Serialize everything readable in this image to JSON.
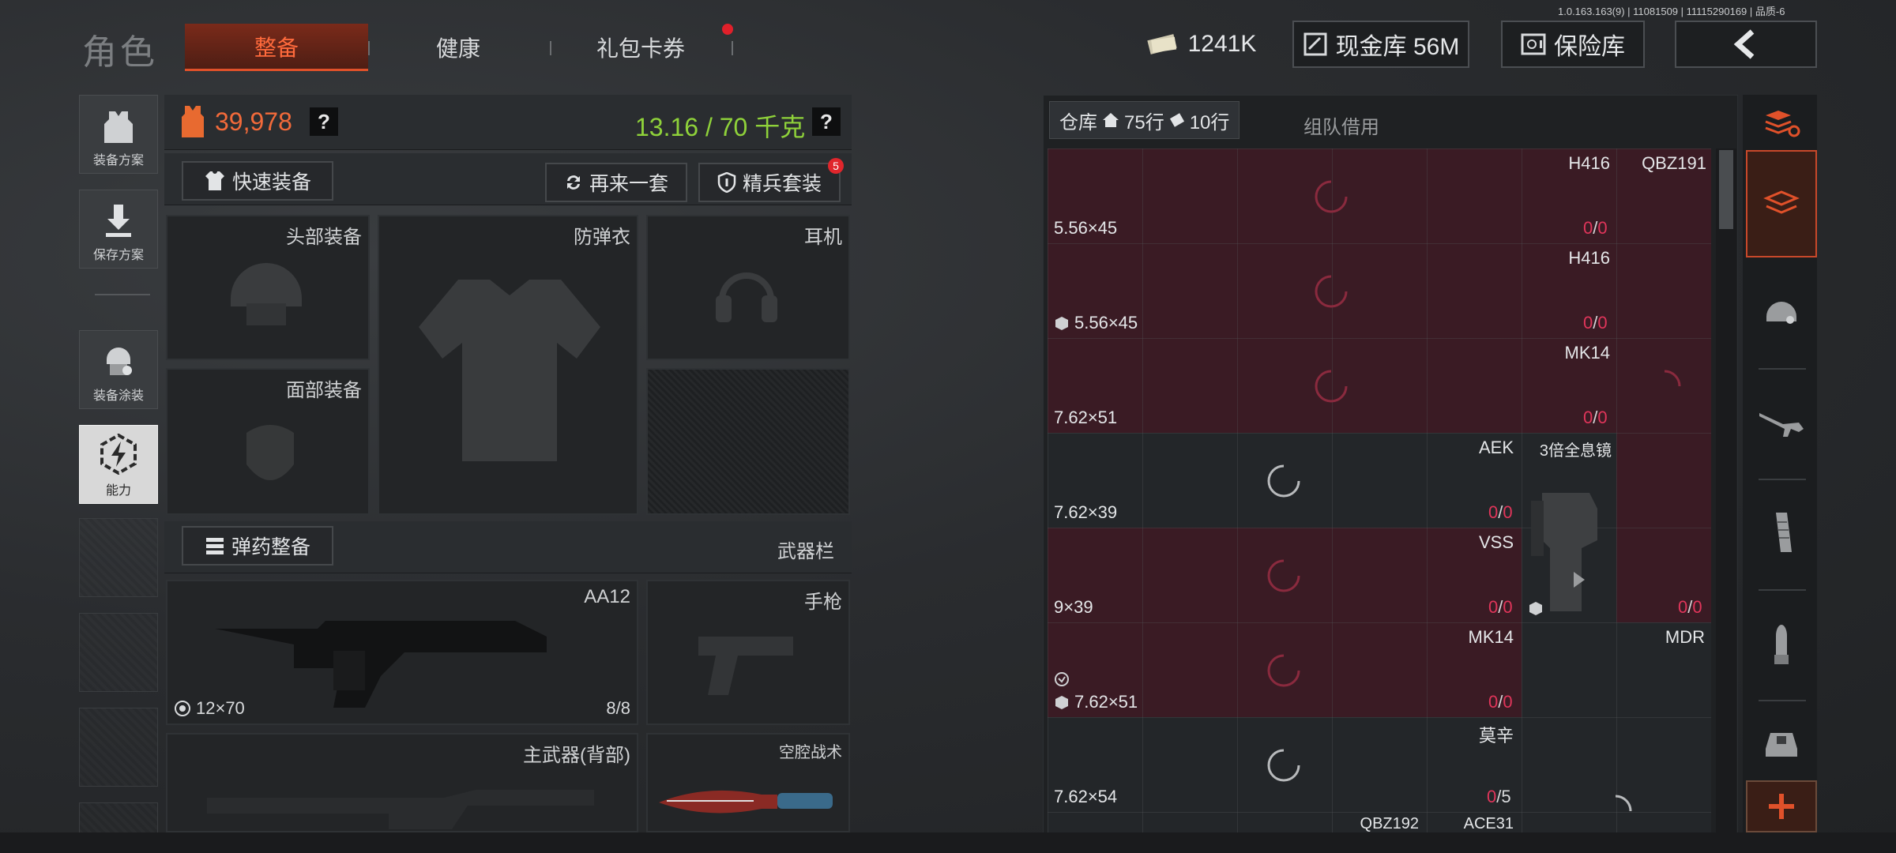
{
  "version": "1.0.163.163(9) | 11081509 | 11115290169 | 品质-6",
  "header": {
    "title": "角色",
    "tabs": [
      "整备",
      "健康",
      "礼包卡券"
    ],
    "money": "1241K",
    "cash_vault": "现金库 56M",
    "safe_box": "保险库"
  },
  "sidebar": {
    "items": [
      "装备方案",
      "保存方案",
      "装备涂装",
      "能力"
    ]
  },
  "equipment": {
    "value": "39,978",
    "weight": "13.16 / 70 千克",
    "help": "?",
    "quick_equip": "快速装备",
    "repeat_set": "再来一套",
    "elite_set": "精兵套装",
    "elite_badge": "5",
    "slots": {
      "head": "头部装备",
      "vest": "防弹衣",
      "earphone": "耳机",
      "face": "面部装备"
    },
    "ammo_button": "弹药整备",
    "weapon_bar": "武器栏",
    "primary": {
      "name": "AA12",
      "ammo": "12×70",
      "count": "8/8"
    },
    "pistol": "手枪",
    "primary_back": "主武器(背部)",
    "melee": "空腔战术"
  },
  "warehouse": {
    "tab_storage": "仓库",
    "rows_home": "75行",
    "rows_ticket": "10行",
    "tab_team": "组队借用",
    "items": [
      {
        "name": "H416",
        "ammo": "5.56×45",
        "cur": "0",
        "max": "0"
      },
      {
        "name": "QBZ191"
      },
      {
        "name": "H416",
        "ammo": "5.56×45",
        "cur": "0",
        "max": "0"
      },
      {
        "name": "MK14",
        "ammo": "7.62×51",
        "cur": "0",
        "max": "0"
      },
      {
        "name": "AEK",
        "ammo": "7.62×39",
        "cur": "0",
        "max": "0"
      },
      {
        "name": "3倍全息镜"
      },
      {
        "name": "VSS",
        "ammo": "9×39",
        "cur": "0",
        "max": "0"
      },
      {
        "name": "",
        "cur": "0",
        "max": "0"
      },
      {
        "name": "MK14",
        "ammo": "7.62×51",
        "cur": "0",
        "max": "0"
      },
      {
        "name": "MDR"
      },
      {
        "name": "莫辛",
        "ammo": "7.62×54",
        "cur": "0",
        "max": "5"
      },
      {
        "name": "QBZ192"
      },
      {
        "name": "ACE31"
      }
    ]
  }
}
